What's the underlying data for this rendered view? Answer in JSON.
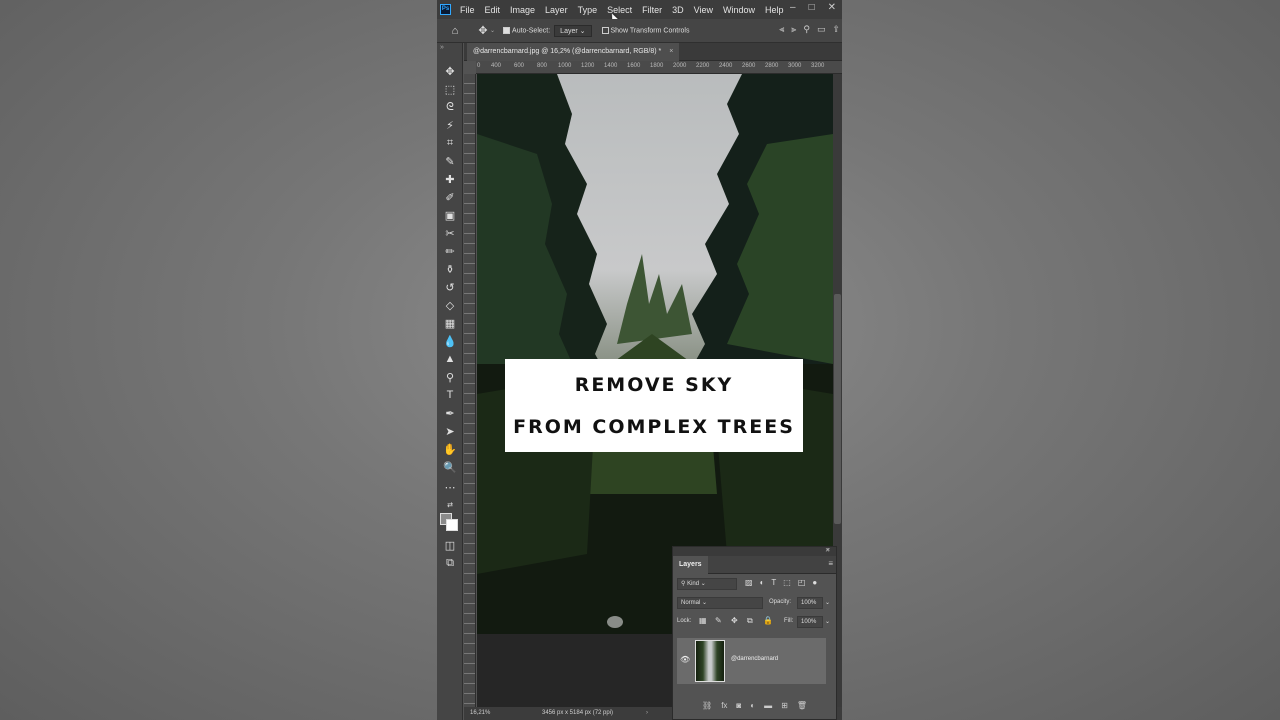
{
  "menu": {
    "logo": "Ps",
    "items": [
      "File",
      "Edit",
      "Image",
      "Layer",
      "Type",
      "Select",
      "Filter",
      "3D",
      "View",
      "Window",
      "Help"
    ],
    "window_controls": [
      "–",
      "□",
      "✕"
    ]
  },
  "options_bar": {
    "auto_select_label": "Auto-Select:",
    "auto_select_target": "Layer",
    "show_transform_label": "Show Transform Controls"
  },
  "toolbar": {
    "collapse": "»",
    "tools": [
      "move-tool",
      "marquee-tool",
      "lasso-tool",
      "magic-wand-tool",
      "crop-tool",
      "eyedropper-tool",
      "healing-brush-tool",
      "brush-tool",
      "stamp-tool",
      "history-brush-tool",
      "eraser-tool",
      "gradient-tool",
      "blur-tool",
      "dodge-tool",
      "pen-tool",
      "type-tool",
      "path-selection-tool",
      "shape-tool",
      "hand-tool",
      "zoom-tool",
      "more-tools"
    ]
  },
  "document": {
    "tab_title": "@darrencbarnard.jpg @ 16,2% (@darrencbarnard, RGB/8) *",
    "close": "×",
    "ruler_ticks": [
      "0",
      "400",
      "600",
      "800",
      "1000",
      "1200",
      "1400",
      "1600",
      "1800",
      "2000",
      "2200",
      "2400",
      "2600",
      "2800",
      "3000",
      "3200"
    ]
  },
  "overlay": {
    "line1": "REMOVE SKY",
    "line2": "FROM COMPLEX TREES"
  },
  "status": {
    "zoom": "16,21%",
    "dimensions": "3456 px x 5184 px (72 ppi)",
    "arrow": "›"
  },
  "layers_panel": {
    "collapse": "«",
    "close": "✕",
    "title": "Layers",
    "filter_kind": "Kind",
    "blend_mode": "Normal",
    "opacity_label": "Opacity:",
    "opacity_value": "100%",
    "lock_label": "Lock:",
    "fill_label": "Fill:",
    "fill_value": "100%",
    "layer_name": "@darrencbarnard"
  }
}
